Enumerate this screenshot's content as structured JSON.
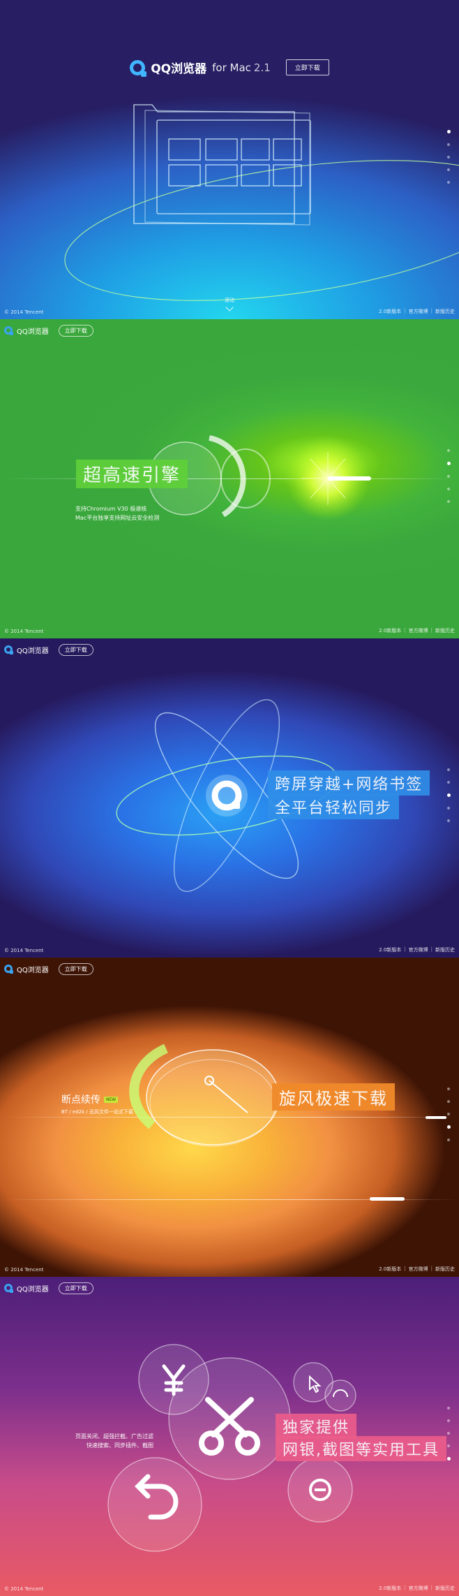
{
  "brand": {
    "name": "QQ浏览器",
    "subtitle": "for Mac",
    "version": "2.1",
    "download_label": "立即下载"
  },
  "hero": {
    "scroll_hint": "滚动"
  },
  "footer": {
    "copyright": "© 2014 Tencent",
    "links": [
      "2.0新版本",
      "官方微博",
      "新版历史"
    ]
  },
  "sections": {
    "engine": {
      "title": "超高速引擎",
      "desc_line1": "支持Chromium V30 极速核",
      "desc_line2": "Mac平台独享支持网址云安全检测"
    },
    "sync": {
      "title_line1": "跨屏穿越+网络书签",
      "title_line2": "全平台轻松同步"
    },
    "download": {
      "title": "旋风极速下载",
      "side_title": "断点续传",
      "badge": "NEW",
      "side_desc": "BT / ed2k / 迅风文件一站式下载"
    },
    "tools": {
      "title_line1": "独家提供",
      "title_line2": "网银,截图等实用工具",
      "desc_line1": "页面关闭、超强拦截、广告过滤",
      "desc_line2": "快速搜索、同步插件、截图"
    }
  },
  "nav_dots": {
    "count": 5
  },
  "colors": {
    "engine_tag": "#5fd03a",
    "sync_tag": "#2f8fe8",
    "download_tag": "#f08a2a",
    "tools_tag": "#ec5d8a"
  },
  "icons": [
    "qq-logo-icon",
    "yen-icon",
    "scissors-icon",
    "undo-icon",
    "cursor-icon",
    "minus-icon"
  ]
}
